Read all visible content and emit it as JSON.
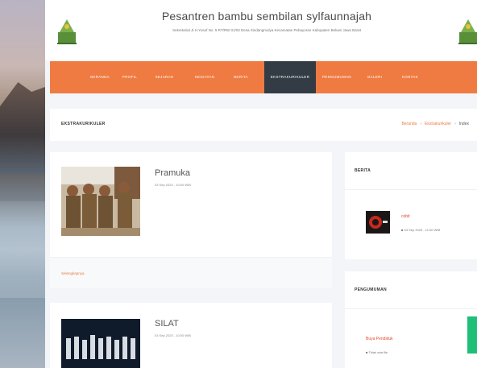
{
  "header": {
    "title": "Pesantren bambu sembilan sylfaunnajah",
    "subtitle": "Sekretariat Jl.H.Yusuf No. 5 RT/RW 01/03 Desa Sindangmulya Kecamatan Pebayuran Kabupaten Bekasi Jawa Barat"
  },
  "nav": {
    "items": [
      {
        "label": "BERANDA",
        "active": false
      },
      {
        "label": "PROFIL",
        "active": false
      },
      {
        "label": "SEJARAH",
        "active": false
      },
      {
        "label": "KEGIATAN",
        "active": false
      },
      {
        "label": "BERITA",
        "active": false
      },
      {
        "label": "EKSTRAKURIKULER",
        "active": true
      },
      {
        "label": "PENGUMUMAN",
        "active": false
      },
      {
        "label": "GALERI",
        "active": false
      },
      {
        "label": "KONTAK",
        "active": false
      }
    ]
  },
  "breadcrumb": {
    "page_title": "EKSTRAKURIKULER",
    "home": "Beranda",
    "section": "Ekstrakurikuler",
    "current": "Index",
    "sep": "›"
  },
  "posts": [
    {
      "title": "Pramuka",
      "date": "03 Sep 2020 - 10:00 WIB",
      "more_label": "Selengkapnya"
    },
    {
      "title": "SILAT",
      "date": "03 Sep 2020 - 10:00 WIB"
    }
  ],
  "sidebar": {
    "news": {
      "heading": "BERITA",
      "item_title": "cobit",
      "item_date": "03 Sep 2020 - 11:00 WIB"
    },
    "announcements": {
      "heading": "PENGUMUMAN",
      "item_title": "Buya Pendiduk",
      "item_meta": "Tidak ada file"
    }
  },
  "colors": {
    "accent": "#ef7b42",
    "nav_active": "#333b44",
    "link_red": "#e24b2b",
    "green_tab": "#1fbf7a"
  }
}
